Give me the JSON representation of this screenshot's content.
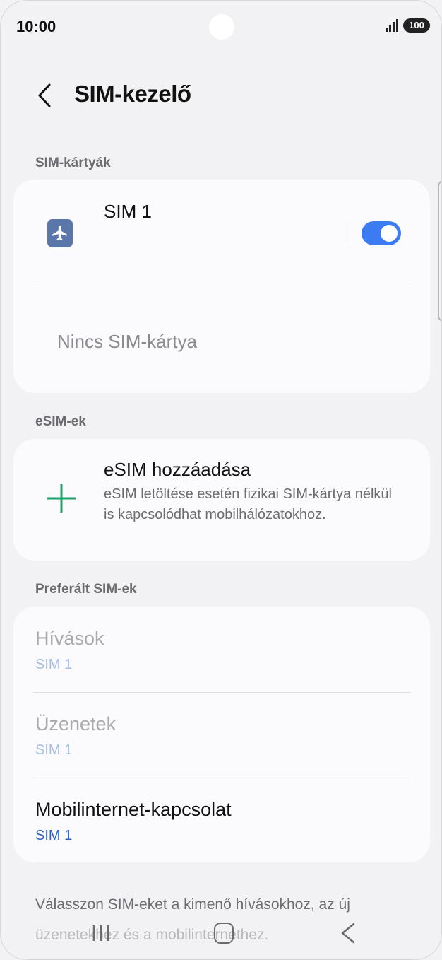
{
  "status": {
    "time": "10:00",
    "battery": "100"
  },
  "header": {
    "title": "SIM-kezelő"
  },
  "sections": {
    "sim_cards": "SIM-kártyák",
    "esims": "eSIM-ek",
    "preferred": "Preferált SIM-ek"
  },
  "sim_card": {
    "name": "SIM 1",
    "toggle_on": true,
    "empty_slot": "Nincs SIM-kártya"
  },
  "esim": {
    "title": "eSIM hozzáadása",
    "description": "eSIM letöltése esetén fizikai SIM-kártya nélkül is kapcsolódhat mobilhálózatokhoz."
  },
  "preferred": [
    {
      "title": "Hívások",
      "value": "SIM 1"
    },
    {
      "title": "Üzenetek",
      "value": "SIM 1"
    },
    {
      "title": "Mobilinternet-kapcsolat",
      "value": "SIM 1"
    }
  ],
  "footer": {
    "line1": "Válasszon SIM-eket a kimenő hívásokhoz, az új",
    "line2": "üzenetekhez és a mobilinternethez."
  },
  "colors": {
    "accent": "#3d7bf2",
    "plane_icon": "#5b76a8",
    "plus": "#1aa36a",
    "link": "#2a5fc4"
  }
}
